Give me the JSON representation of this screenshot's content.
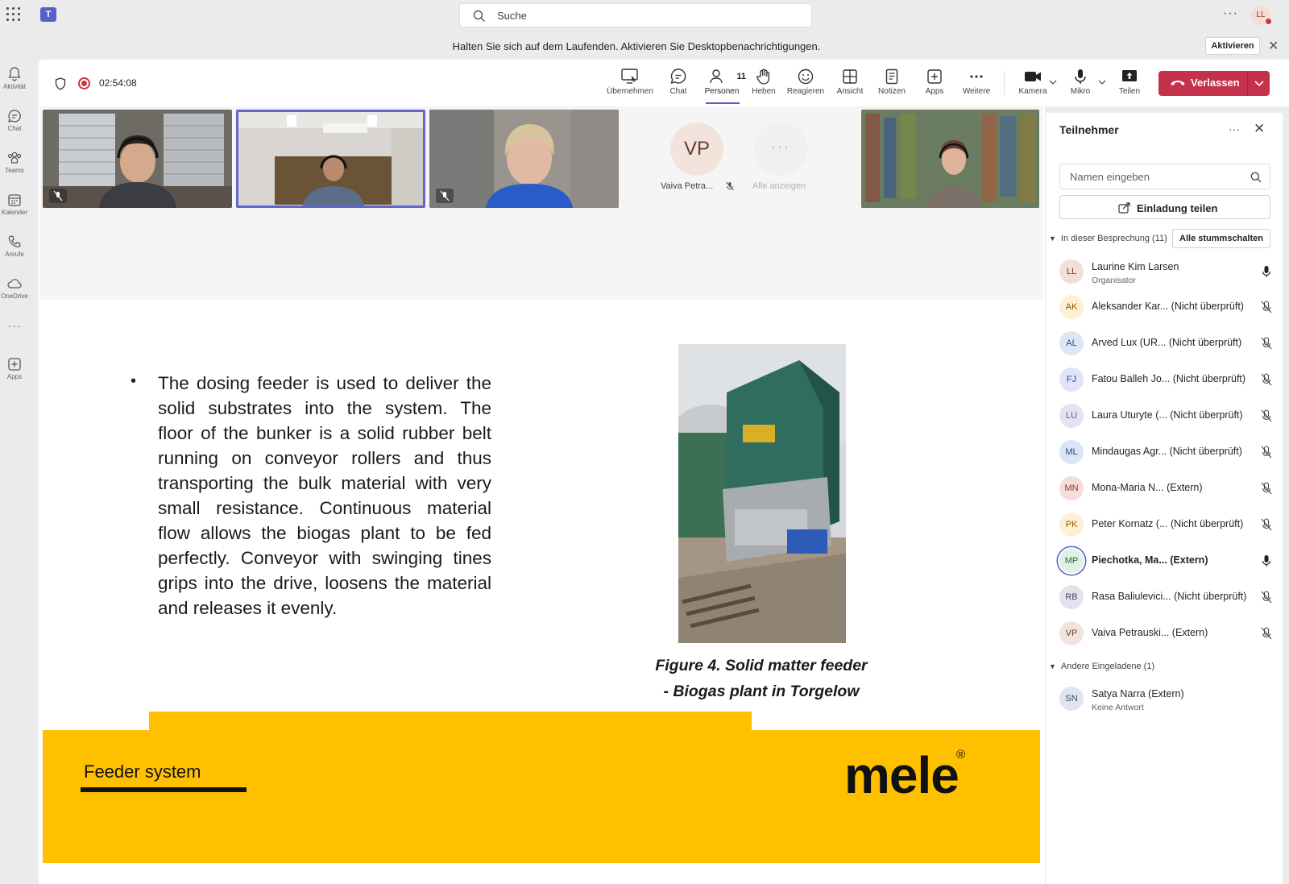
{
  "titlebar": {
    "app_logo": "T",
    "search_placeholder": "Suche",
    "avatar": "LL",
    "more": "···"
  },
  "notification": {
    "text": "Halten Sie sich auf dem Laufenden. Aktivieren Sie Desktopbenachrichtigungen.",
    "button": "Aktivieren"
  },
  "rail": [
    {
      "label": "Aktivität",
      "icon": "bell-icon"
    },
    {
      "label": "Chat",
      "icon": "chat-icon"
    },
    {
      "label": "Teams",
      "icon": "teams-icon"
    },
    {
      "label": "Kalender",
      "icon": "calendar-icon"
    },
    {
      "label": "Anrufe",
      "icon": "phone-icon"
    },
    {
      "label": "OneDrive",
      "icon": "cloud-icon"
    },
    {
      "label": "···",
      "icon": "more-icon"
    },
    {
      "label": "Apps",
      "icon": "apps-icon"
    }
  ],
  "meeting": {
    "timer": "02:54:08",
    "toolbar": [
      {
        "label": "Übernehmen",
        "icon": "share-screen-icon"
      },
      {
        "label": "Chat",
        "icon": "chat-icon"
      },
      {
        "label": "Personen",
        "icon": "people-icon",
        "count": "11"
      },
      {
        "label": "Heben",
        "icon": "hand-icon"
      },
      {
        "label": "Reagieren",
        "icon": "smile-icon"
      },
      {
        "label": "Ansicht",
        "icon": "grid-icon"
      },
      {
        "label": "Notizen",
        "icon": "notes-icon"
      },
      {
        "label": "Apps",
        "icon": "add-icon"
      },
      {
        "label": "Weitere",
        "icon": "more-icon"
      },
      {
        "label": "Kamera",
        "icon": "camera-icon"
      },
      {
        "label": "Mikro",
        "icon": "mic-icon"
      },
      {
        "label": "Teilen",
        "icon": "share-icon"
      }
    ],
    "leave_label": "Verlassen",
    "videos": {
      "vp_initials": "VP",
      "vp_name": "Vaiva Petra...",
      "show_all": "Alle anzeigen"
    }
  },
  "slide": {
    "body": "The dosing feeder is used to deliver the solid substrates into the system. The floor of the bunker is a solid rubber belt running on conveyor rollers and thus transporting the bulk material with very small resistance. Continuous material flow allows the biogas plant to be fed perfectly. Conveyor with swinging tines grips into the drive, loosens the material and releases it evenly.",
    "caption_line1": "Figure 4. Solid matter feeder",
    "caption_line2": "- Biogas plant in Torgelow",
    "footer_label": "Feeder system",
    "brand": "mele",
    "brand_mark": "®"
  },
  "panel": {
    "title": "Teilnehmer",
    "search_placeholder": "Namen eingeben",
    "invite": "Einladung teilen",
    "in_meeting": "In dieser Besprechung (11)",
    "mute_all": "Alle stummschalten",
    "others": "Andere Eingeladene (1)",
    "participants": [
      {
        "initials": "LL",
        "name": "Laurine Kim Larsen",
        "sub": "Organisator",
        "mic": "on",
        "bg": "#f3dfd8",
        "fg": "#7a3b2a"
      },
      {
        "initials": "AK",
        "name": "Aleksander Kar... (Nicht überprüft)",
        "sub": "",
        "mic": "off",
        "bg": "#fdf0d5",
        "fg": "#8a5a00"
      },
      {
        "initials": "AL",
        "name": "Arved Lux (UR... (Nicht überprüft)",
        "sub": "",
        "mic": "off",
        "bg": "#dce6f4",
        "fg": "#2b4c7e"
      },
      {
        "initials": "FJ",
        "name": "Fatou Balleh Jo... (Nicht überprüft)",
        "sub": "",
        "mic": "off",
        "bg": "#dfe4f7",
        "fg": "#3b4d9b"
      },
      {
        "initials": "LU",
        "name": "Laura Uturyte (... (Nicht überprüft)",
        "sub": "",
        "mic": "off",
        "bg": "#e5e3f3",
        "fg": "#5b5aa0"
      },
      {
        "initials": "ML",
        "name": "Mindaugas Agr... (Nicht überprüft)",
        "sub": "",
        "mic": "off",
        "bg": "#dbe5f3",
        "fg": "#2b4c7e"
      },
      {
        "initials": "MN",
        "name": "Mona-Maria N... (Extern)",
        "sub": "",
        "mic": "off",
        "bg": "#f6ddd6",
        "fg": "#8a3a28"
      },
      {
        "initials": "PK",
        "name": "Peter Kornatz (... (Nicht überprüft)",
        "sub": "",
        "mic": "off",
        "bg": "#fdf0d5",
        "fg": "#8a5a00"
      },
      {
        "initials": "MP",
        "name": "Piechotka, Ma... (Extern)",
        "sub": "",
        "mic": "on",
        "bg": "#dff0e4",
        "fg": "#2e6b3f",
        "bold": true
      },
      {
        "initials": "RB",
        "name": "Rasa Baliulevici... (Nicht überprüft)",
        "sub": "",
        "mic": "off",
        "bg": "#e3e3ee",
        "fg": "#444466"
      },
      {
        "initials": "VP",
        "name": "Vaiva Petrauski... (Extern)",
        "sub": "",
        "mic": "off",
        "bg": "#f2e4dc",
        "fg": "#6b3b2a"
      }
    ],
    "invited": {
      "initials": "SN",
      "name": "Satya Narra (Extern)",
      "sub": "Keine Antwort"
    }
  }
}
